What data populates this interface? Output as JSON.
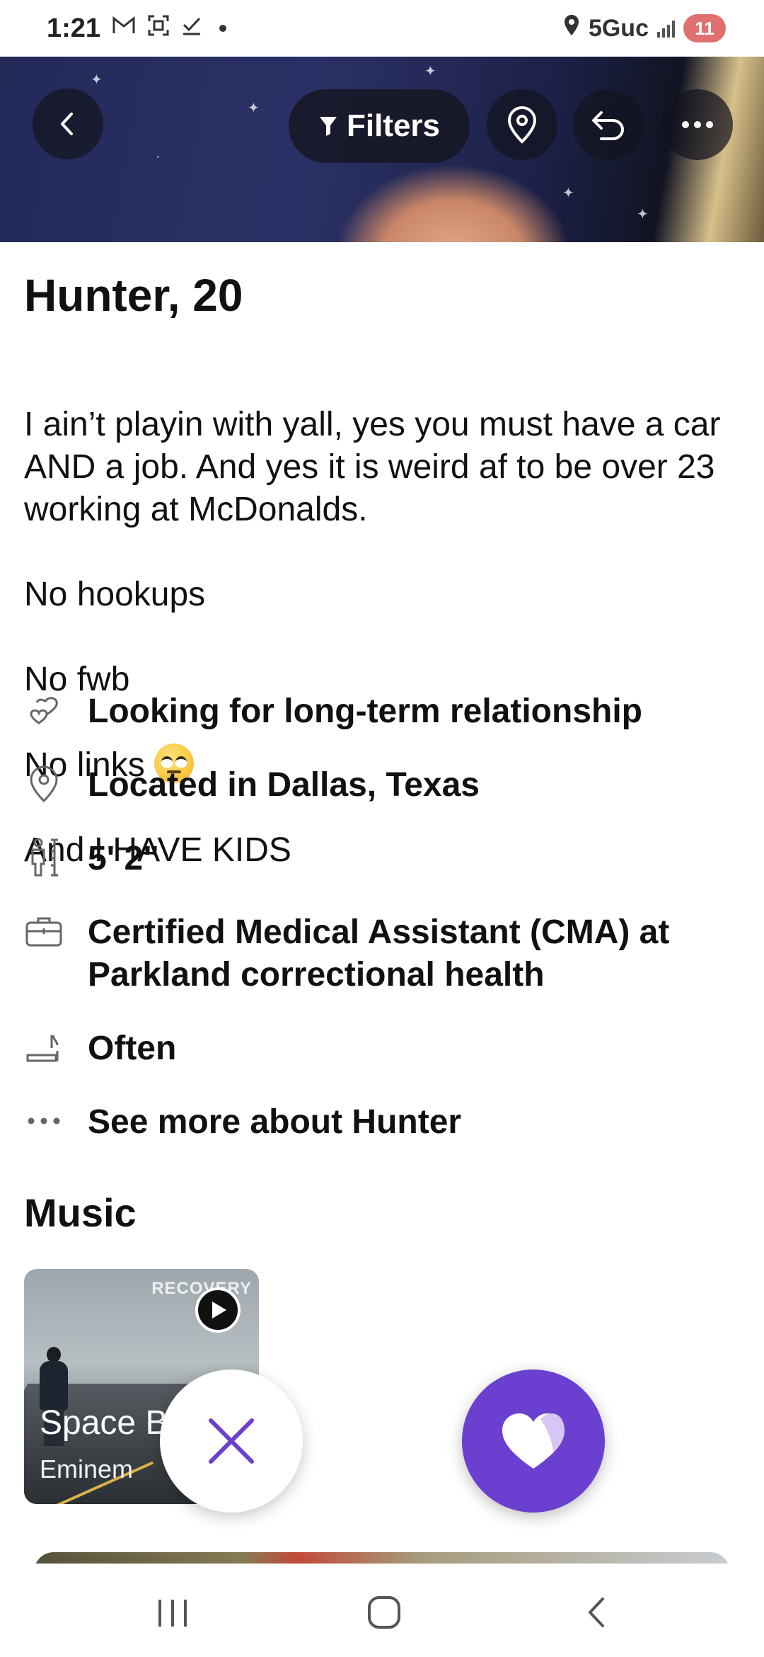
{
  "status_bar": {
    "time": "1:21",
    "network": "5Guc",
    "battery": "11"
  },
  "header": {
    "filters_label": "Filters"
  },
  "profile": {
    "name_age": "Hunter, 20",
    "bio_lines": [
      "I ain’t playin with yall, yes you must have a car AND a job. And yes it is weird af to be over 23 working at McDonalds.",
      "No hookups",
      "No fwb",
      "No links",
      "And I HAVE KIDS"
    ],
    "bio_emoji": "face-with-rolling-eyes",
    "details": [
      {
        "icon": "hearts-icon",
        "text": "Looking for long-term relationship"
      },
      {
        "icon": "location-pin-icon",
        "text": "Located in Dallas, Texas"
      },
      {
        "icon": "height-icon",
        "text": "5' 2\""
      },
      {
        "icon": "briefcase-icon",
        "text": "Certified Medical Assistant (CMA) at Parkland correctional health"
      },
      {
        "icon": "smoking-icon",
        "text": "Often"
      },
      {
        "icon": "more-dots-icon",
        "text": "See more about Hunter"
      }
    ]
  },
  "music": {
    "section_title": "Music",
    "album_brand": "RECOVERY",
    "song_title": "Space B",
    "artist": "Eminem"
  },
  "colors": {
    "accent": "#6b3fcf",
    "battery": "#e07070"
  }
}
